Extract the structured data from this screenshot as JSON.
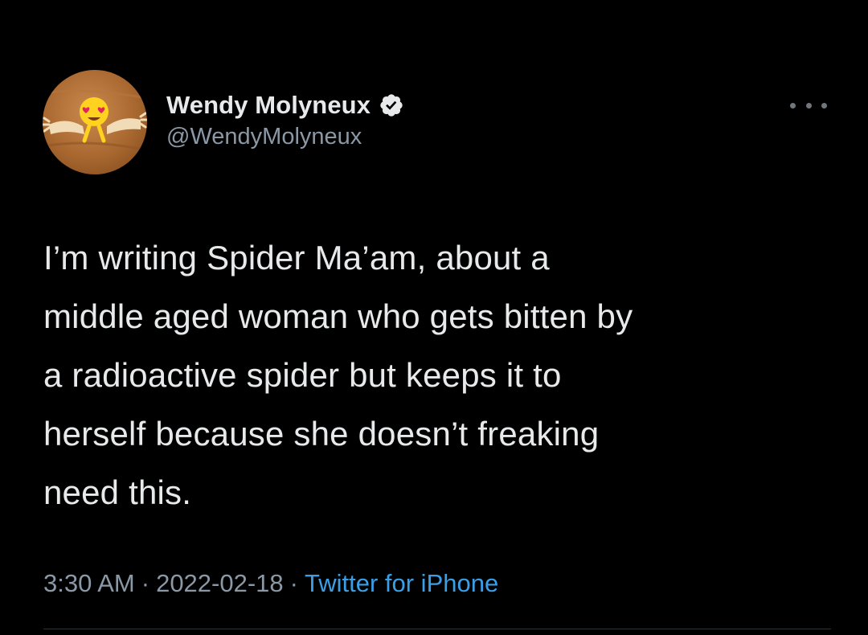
{
  "author": {
    "display_name": "Wendy Molyneux",
    "handle": "@WendyMolyneux",
    "verified": true,
    "avatar_icon": "heart-eyes-emoji-hug-icon"
  },
  "tweet": {
    "text": "I’m writing Spider Ma’am, about a\nmiddle aged woman who gets bitten by\na radioactive spider but keeps it to\nherself because she doesn’t freaking\nneed this."
  },
  "meta": {
    "time": "3:30 AM",
    "separator": "·",
    "date": "2022-02-18",
    "source": "Twitter for iPhone"
  },
  "colors": {
    "background": "#000000",
    "text": "#e7e9ea",
    "secondary": "#8b98a5",
    "link": "#3a9fe6",
    "verified_badge": "#e7e9ea"
  },
  "icons": {
    "more": "more-dots-icon",
    "verified": "verified-badge-icon"
  }
}
